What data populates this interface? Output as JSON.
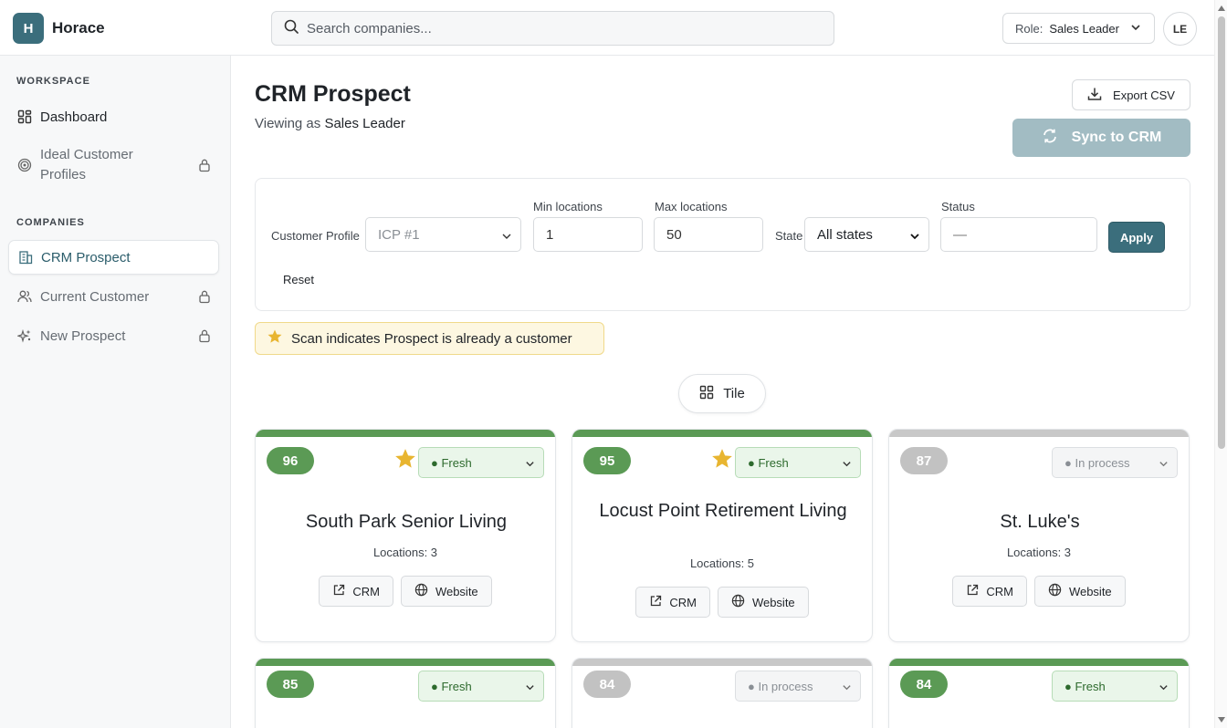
{
  "header": {
    "logo_letter": "H",
    "app_name": "Horace",
    "search_placeholder": "Search companies...",
    "role_label": "Role:",
    "role_value": "Sales Leader",
    "avatar_initials": "LE"
  },
  "sidebar": {
    "workspace_title": "WORKSPACE",
    "companies_title": "COMPANIES",
    "workspace_items": [
      {
        "label": "Dashboard",
        "icon": "dashboard-icon",
        "locked": false
      },
      {
        "label": "Ideal Customer Profiles",
        "icon": "target-icon",
        "locked": true
      }
    ],
    "company_items": [
      {
        "label": "CRM Prospect",
        "icon": "building-icon",
        "locked": false,
        "active": true
      },
      {
        "label": "Current Customer",
        "icon": "users-icon",
        "locked": true
      },
      {
        "label": "New Prospect",
        "icon": "sparkle-icon",
        "locked": true
      }
    ]
  },
  "page": {
    "title": "CRM Prospect",
    "viewing_prefix": "Viewing as",
    "viewing_role": "Sales Leader",
    "export_label": "Export CSV",
    "sync_label": "Sync to CRM"
  },
  "filters": {
    "customer_profile_label": "Customer Profile",
    "customer_profile_value": "ICP #1",
    "min_locations_label": "Min locations",
    "min_locations_value": "1",
    "max_locations_label": "Max locations",
    "max_locations_value": "50",
    "state_label": "State",
    "state_value": "All states",
    "status_label": "Status",
    "status_placeholder": "—",
    "apply_label": "Apply",
    "reset_label": "Reset"
  },
  "legend_note": "Scan indicates Prospect is already a customer",
  "view_toggle": "Tile",
  "colors": {
    "accent": "#3b6e7c",
    "fresh": "#5b9a55",
    "in_process": "#c8c8c8",
    "star": "#e8b530"
  },
  "cards": [
    {
      "score": "96",
      "starred": true,
      "status": "Fresh",
      "name": "South Park Senior Living",
      "locations": "Locations: 3",
      "crm_label": "CRM",
      "website_label": "Website"
    },
    {
      "score": "95",
      "starred": true,
      "status": "Fresh",
      "name": "Locust Point Retirement Living",
      "locations": "Locations: 5",
      "crm_label": "CRM",
      "website_label": "Website"
    },
    {
      "score": "87",
      "starred": false,
      "status": "In process",
      "name": "St. Luke's",
      "locations": "Locations: 3",
      "crm_label": "CRM",
      "website_label": "Website"
    },
    {
      "score": "85",
      "starred": false,
      "status": "Fresh"
    },
    {
      "score": "84",
      "starred": false,
      "status": "In process"
    },
    {
      "score": "84",
      "starred": false,
      "status": "Fresh"
    }
  ]
}
